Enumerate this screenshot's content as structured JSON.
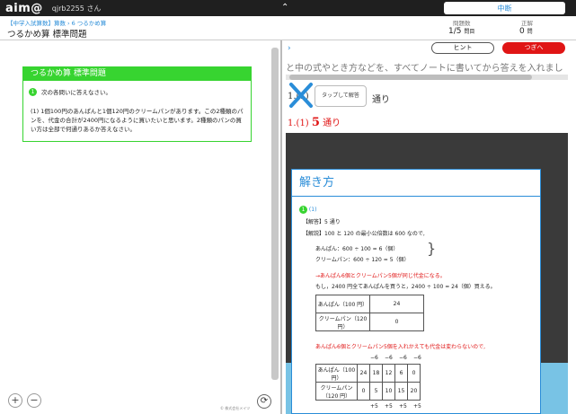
{
  "topbar": {
    "logo": "aim@",
    "user": "qjrb2255 さん",
    "pause": "中断"
  },
  "header": {
    "crumb_a": "【中学入試算数】算数",
    "crumb_b": "6 つるかめ算",
    "title": "つるかめ算 標準問題",
    "stat1_label": "問題数",
    "stat1_value": "1/5",
    "stat1_unit": "問目",
    "stat2_label": "正解",
    "stat2_value": "0",
    "stat2_unit": "問"
  },
  "left": {
    "card_title": "つるかめ算 標準問題",
    "q_number": "1",
    "q_instruction": "次の各問いに答えなさい。",
    "q_body": "(1) 1個100円のあんぱんと1個120円のクリームパンがあります。この2種類のパンを、代金の合計が2400円になるように買いたいと思います。2種類のパンの買い方は全部で何通りあるか答えなさい。",
    "zoom_in": "+",
    "zoom_out": "−",
    "copyright": "© 株式会社メイツ",
    "reload": "⟳"
  },
  "right": {
    "chevron": "›",
    "hint": "ヒント",
    "next": "つぎへ",
    "top_line": "と中の式やとき方などを、すべてノートに書いてから答えを入れまし",
    "prob_label": "1.(1)",
    "tap": "タップして解答",
    "tori": "通り",
    "answer_prefix": "1.(1)",
    "answer_value": "5",
    "answer_suffix": "通り"
  },
  "solution": {
    "title": "解き方",
    "num": "1",
    "sub": "(1)",
    "answer_line": "【解答】5 通り",
    "explain_line": "【解説】100 と 120 の最小公倍数は 600 なので,",
    "calc1": "あんぱん：600 ÷ 100 = 6（個）",
    "calc2": "クリームパン：600 ÷ 120 = 5（個）",
    "red1": "→あんぱん6個とクリームパン5個が同じ代金になる。",
    "line2": "もし，2400 円全てあんぱんを買うと，2400 ÷ 100 = 24（個）買える。",
    "t1": {
      "r1_label": "あんぱん（100 円）",
      "r1_val": "24",
      "r2_label": "クリームパン（120 円）",
      "r2_val": "0"
    },
    "red2": "あんぱん6個とクリームパン5個を入れかえても代金は変わらないので,",
    "minus": [
      "−6",
      "−6",
      "−6",
      "−6"
    ],
    "plus": [
      "+5",
      "+5",
      "+5",
      "+5"
    ],
    "t2": {
      "r1_label": "あんぱん（100 円）",
      "r1": [
        "24",
        "18",
        "12",
        "6",
        "0"
      ],
      "r2_label": "クリームパン（120 円）",
      "r2": [
        "0",
        "5",
        "10",
        "15",
        "20"
      ]
    }
  }
}
